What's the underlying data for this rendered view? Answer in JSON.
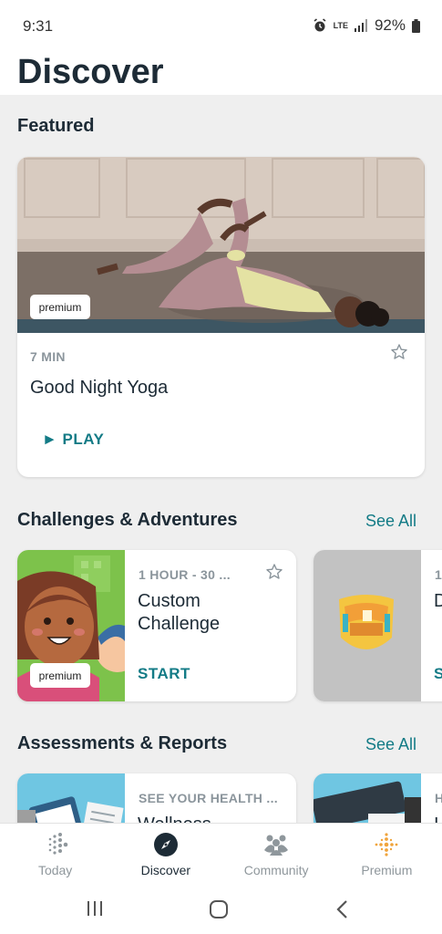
{
  "status_bar": {
    "time": "9:31",
    "network": "LTE",
    "battery": "92%"
  },
  "header": {
    "title": "Discover"
  },
  "featured": {
    "section_title": "Featured",
    "card": {
      "badge": "premium",
      "duration": "7 MIN",
      "title": "Good Night Yoga",
      "action": "► PLAY"
    }
  },
  "challenges": {
    "section_title": "Challenges & Adventures",
    "see_all": "See All",
    "cards": [
      {
        "badge": "premium",
        "meta": "1 HOUR - 30 ...",
        "title": "Custom Challenge",
        "action": "START"
      },
      {
        "meta": "1",
        "title": "D",
        "action": "S"
      }
    ]
  },
  "assessments": {
    "section_title": "Assessments & Reports",
    "see_all": "See All",
    "cards": [
      {
        "meta": "SEE YOUR HEALTH ...",
        "title": "Wellness"
      },
      {
        "meta": "H",
        "title": "I"
      }
    ]
  },
  "bottom_nav": {
    "items": [
      "Today",
      "Discover",
      "Community",
      "Premium"
    ],
    "active": "Discover"
  },
  "colors": {
    "accent": "#137b86",
    "title": "#1d2b36",
    "background": "#efefef",
    "premium_gold": "#f0a43c"
  },
  "icons": [
    "alarm-icon",
    "signal-icon",
    "battery-icon",
    "star-outline-icon",
    "compass-icon",
    "fitbit-dots-icon",
    "community-icon",
    "premium-icon",
    "recents-icon",
    "home-icon",
    "back-icon"
  ]
}
